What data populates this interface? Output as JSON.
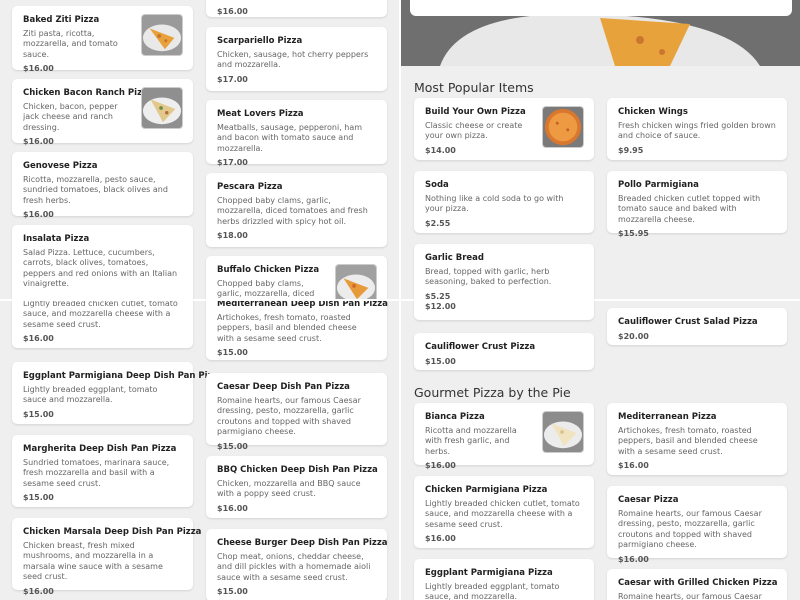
{
  "tl": {
    "col1": [
      {
        "name": "Baked Ziti Pizza",
        "desc": "Ziti pasta, ricotta, mozzarella, and tomato sauce.",
        "price": "$16.00"
      },
      {
        "name": "Chicken Bacon Ranch Pizza",
        "desc": "Chicken, bacon, pepper jack cheese and ranch dressing.",
        "price": "$16.00"
      },
      {
        "name": "Genovese Pizza",
        "desc": "Ricotta, mozzarella, pesto sauce, sundried tomatoes, black olives and fresh herbs.",
        "price": "$16.00"
      },
      {
        "name": "Insalata Pizza",
        "desc": "Salad Pizza. Lettuce, cucumbers, carrots, black olives, tomatoes, peppers and red onions with an Italian vinaigrette."
      }
    ],
    "col2": [
      {
        "price": "$16.00"
      },
      {
        "name": "Scarpariello Pizza",
        "desc": "Chicken, sausage, hot cherry peppers and mozzarella.",
        "price": "$17.00"
      },
      {
        "name": "Meat Lovers Pizza",
        "desc": "Meatballs, sausage, pepperoni, ham and bacon with tomato sauce and mozzarella.",
        "price": "$17.00"
      },
      {
        "name": "Pescara Pizza",
        "desc": "Chopped baby clams, garlic, mozzarella, diced tomatoes and fresh herbs drizzled with spicy hot oil.",
        "price": "$18.00"
      },
      {
        "name": "Buffalo Chicken Pizza",
        "desc": "Chopped baby clams, garlic, mozzarella, diced tomatoes and"
      }
    ]
  },
  "tr": {
    "section_title": "Most Popular Items",
    "items": [
      {
        "name": "Build Your Own Pizza",
        "desc": "Classic cheese or create your own pizza.",
        "price": "$14.00"
      },
      {
        "name": "Chicken Wings",
        "desc": "Fresh chicken wings fried golden brown and choice of sauce.",
        "price": "$9.95"
      },
      {
        "name": "Soda",
        "desc": "Nothing like a cold soda to go with your pizza.",
        "price": "$2.55"
      },
      {
        "name": "Pollo Parmigiana",
        "desc": "Breaded chicken cutlet topped with tomato sauce and baked with mozzarella cheese.",
        "price": "$15.95"
      },
      {
        "name": "Garlic Bread",
        "desc": "Bread, topped with garlic, herb seasoning, baked to perfection.",
        "price": "$5.25"
      }
    ]
  },
  "bl": {
    "col1": [
      {
        "desc": "Lightly breaded chicken cutlet, tomato sauce, and mozzarella cheese with a sesame seed crust.",
        "price": "$16.00"
      },
      {
        "name": "Eggplant Parmigiana Deep Dish Pan Pizza",
        "desc": "Lightly breaded eggplant, tomato sauce and mozzarella.",
        "price": "$15.00"
      },
      {
        "name": "Margherita Deep Dish Pan Pizza",
        "desc": "Sundried tomatoes, marinara sauce, fresh mozzarella and basil with a sesame seed crust.",
        "price": "$15.00"
      },
      {
        "name": "Chicken Marsala Deep Dish Pan Pizza",
        "desc": "Chicken breast, fresh mixed mushrooms, and mozzarella in a marsala wine sauce with a sesame seed crust.",
        "price": "$16.00"
      }
    ],
    "col2": [
      {
        "name": "Mediterranean Deep Dish Pan Pizza",
        "desc": "Artichokes, fresh tomato, roasted peppers, basil and blended cheese with a sesame seed crust.",
        "price": "$15.00"
      },
      {
        "name": "Caesar Deep Dish Pan Pizza",
        "desc": "Romaine hearts, our famous Caesar dressing, pesto, mozzarella, garlic croutons and topped with shaved parmigiano cheese.",
        "price": "$15.00"
      },
      {
        "name": "BBQ Chicken Deep Dish Pan Pizza",
        "desc": "Chicken, mozzarella and BBQ sauce with a poppy seed crust.",
        "price": "$16.00"
      },
      {
        "name": "Cheese Burger Deep Dish Pan Pizza",
        "desc": "Chop meat, onions, cheddar cheese, and dill pickles with a homemade aioli sauce with a sesame seed crust.",
        "price": "$15.00"
      }
    ]
  },
  "br": {
    "top_left": {
      "price": "$12.00"
    },
    "top_right": {
      "name": "Cauliflower Crust Salad Pizza",
      "price": "$20.00"
    },
    "cauliflower": {
      "name": "Cauliflower Crust Pizza",
      "price": "$15.00"
    },
    "section_title": "Gourmet Pizza by the Pie",
    "items": [
      {
        "name": "Bianca Pizza",
        "desc": "Ricotta and mozzarella with fresh garlic, and herbs.",
        "price": "$16.00"
      },
      {
        "name": "Mediterranean Pizza",
        "desc": "Artichokes, fresh tomato, roasted peppers, basil and blended cheese with a sesame seed crust.",
        "price": "$16.00"
      },
      {
        "name": "Chicken Parmigiana Pizza",
        "desc": "Lightly breaded chicken cutlet, tomato sauce, and mozzarella cheese with a sesame seed crust.",
        "price": "$16.00"
      },
      {
        "name": "Caesar Pizza",
        "desc": "Romaine hearts, our famous Caesar dressing, pesto, mozzarella, garlic croutons and topped with shaved parmigiano cheese.",
        "price": "$16.00"
      },
      {
        "name": "Eggplant Parmigiana Pizza",
        "desc": "Lightly breaded eggplant, tomato sauce, and mozzarella."
      },
      {
        "name": "Caesar with Grilled Chicken Pizza",
        "desc": "Romaine hearts, our famous Caesar dressing"
      }
    ]
  },
  "icons": {
    "thumb": "pizza-slice-photo"
  }
}
